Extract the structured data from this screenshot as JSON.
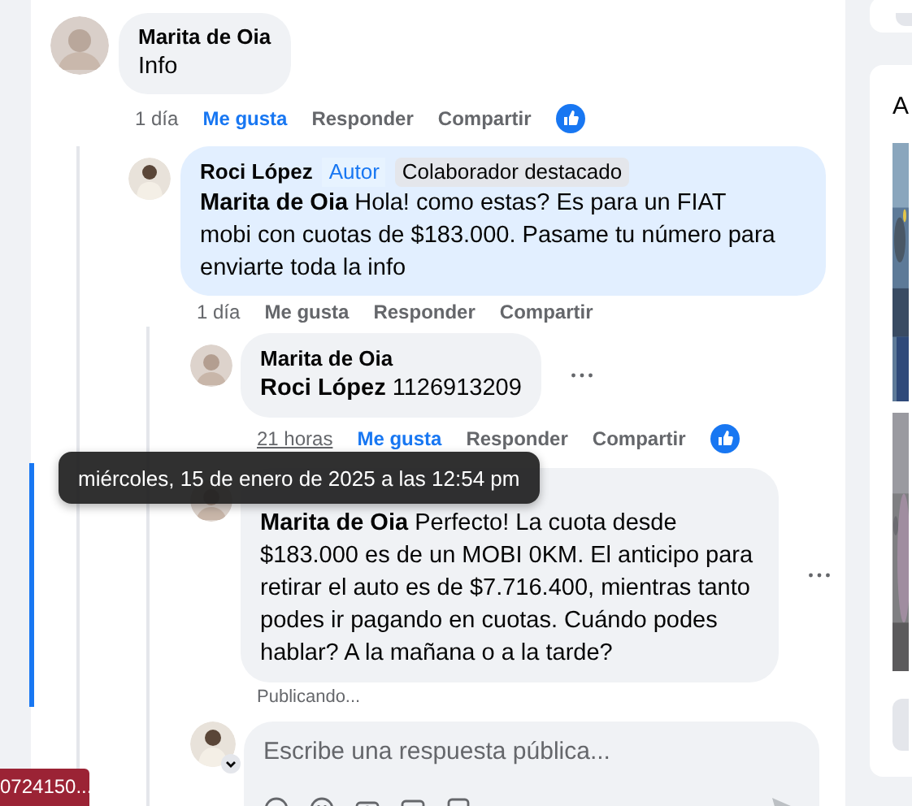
{
  "thread": {
    "author": "Marita de Oia",
    "text": "Info",
    "time": "1 día",
    "like": "Me gusta",
    "liked": true,
    "actions": [
      "Responder",
      "Compartir"
    ],
    "reaction": true,
    "replies": [
      {
        "author": "Roci López",
        "badges": [
          {
            "label": "Autor",
            "kind": "role"
          },
          {
            "label": "Colaborador destacado",
            "kind": "tag"
          }
        ],
        "text": "**Marita de Oia** Hola! como estas? Es para un FIAT mobi con cuotas de $183.000. Pasame tu número para enviarte toda la info",
        "time": "1 día",
        "like": "Me gusta",
        "liked": false,
        "actions": [
          "Responder",
          "Compartir"
        ],
        "highlighted": true,
        "replies": [
          {
            "author": "Marita de Oia",
            "text": "**Roci López** 1126913209",
            "time": "21 horas",
            "time_hovered": true,
            "like": "Me gusta",
            "liked": true,
            "actions": [
              "Responder",
              "Compartir"
            ],
            "reaction": true,
            "menu": true
          },
          {
            "text": "**Marita de Oia** Perfecto! La cuota desde $183.000 es de un MOBI 0KM. El anticipo para retirar el auto es de $7.716.400, mientras tanto podes ir pagando en cuotas. Cuándo podes hablar? A la mañana o a la tarde?",
            "status": "Publicando...",
            "menu": true,
            "focused": true
          }
        ]
      }
    ]
  },
  "reply_field": {
    "placeholder": "Escribe una respuesta pública..."
  },
  "tooltip": "miércoles, 15 de enero de 2025 a las 12:54 pm",
  "side_card": {
    "heading": "A"
  },
  "corner_badge": "0724150..."
}
